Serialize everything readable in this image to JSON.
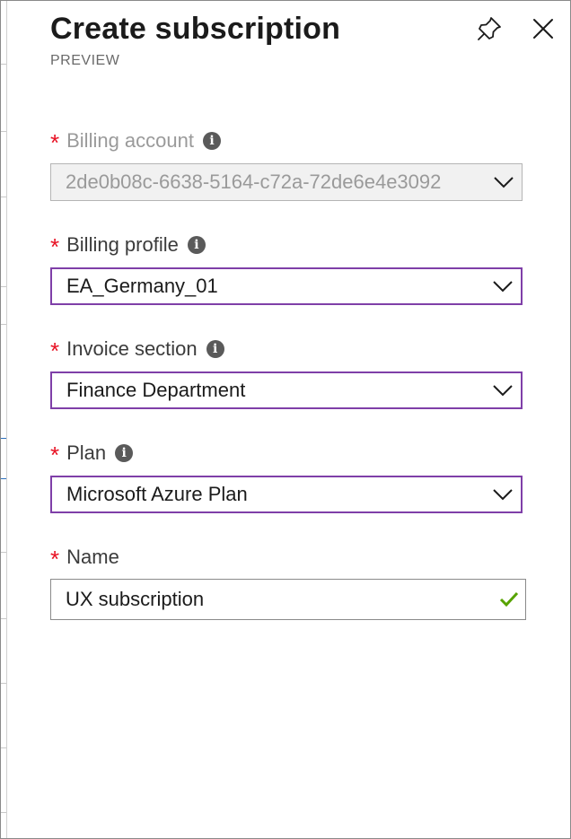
{
  "header": {
    "title": "Create subscription",
    "subtitle": "PREVIEW",
    "pin_icon": "pin-icon",
    "close_icon": "close-icon"
  },
  "form": {
    "required_marker": "*",
    "billing_account": {
      "label": "Billing account",
      "value": "2de0b08c-6638-5164-c72a-72de6e4e3092",
      "disabled": true
    },
    "billing_profile": {
      "label": "Billing profile",
      "value": "EA_Germany_01"
    },
    "invoice_section": {
      "label": "Invoice section",
      "value": "Finance Department"
    },
    "plan": {
      "label": "Plan",
      "value": "Microsoft Azure Plan"
    },
    "name": {
      "label": "Name",
      "value": "UX subscription",
      "valid": true
    }
  },
  "colors": {
    "required": "#e81123",
    "focus_border": "#7f3fa8",
    "valid_check": "#57a300"
  }
}
